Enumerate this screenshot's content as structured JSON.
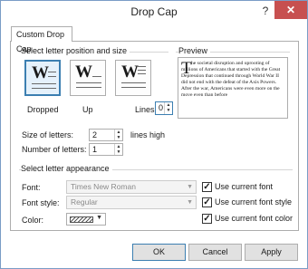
{
  "window": {
    "title": "Drop Cap",
    "help_symbol": "?",
    "close_symbol": "✕"
  },
  "tab": {
    "label": "Custom Drop Cap"
  },
  "position_group": {
    "title": "Select letter position and size",
    "options": [
      {
        "label": "Dropped",
        "glyph": "W",
        "selected": true
      },
      {
        "label": "Up",
        "glyph": "W",
        "selected": false
      },
      {
        "label": "Lines",
        "glyph": "W",
        "selected": false
      }
    ],
    "lines_value": "0",
    "size_label": "Size of letters:",
    "size_value": "2",
    "size_unit": "lines high",
    "number_label": "Number of letters:",
    "number_value": "1"
  },
  "preview": {
    "title": "Preview",
    "dropcap": "T",
    "text": "he societal disruption and uprooting of millions of Americans that started with the Great Depression that continued through World War II did not end with the defeat of the Axis Powers. After the war, Americans were even more on the move even than before"
  },
  "appearance_group": {
    "title": "Select letter appearance",
    "font_label": "Font:",
    "font_value": "Times New Roman",
    "style_label": "Font style:",
    "style_value": "Regular",
    "color_label": "Color:",
    "check_font": "Use current font",
    "check_style": "Use current font style",
    "check_color": "Use current font color",
    "check_mark": "✓"
  },
  "buttons": {
    "ok": "OK",
    "cancel": "Cancel",
    "apply": "Apply"
  }
}
